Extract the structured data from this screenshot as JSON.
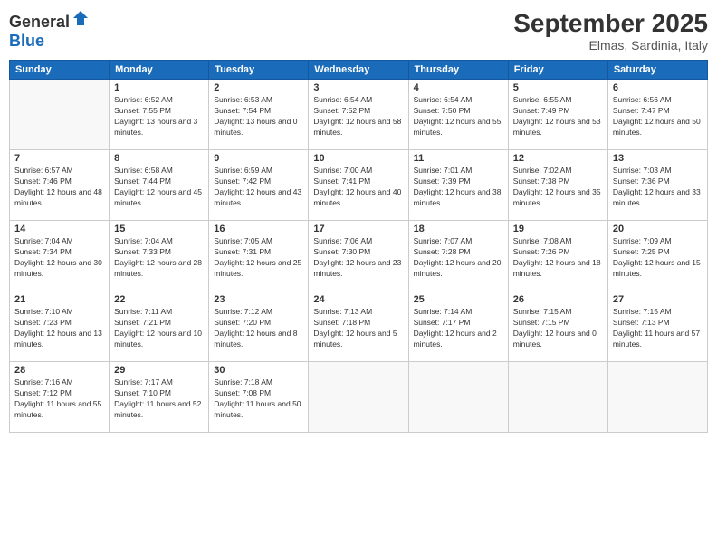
{
  "logo": {
    "general": "General",
    "blue": "Blue"
  },
  "header": {
    "month": "September 2025",
    "location": "Elmas, Sardinia, Italy"
  },
  "weekdays": [
    "Sunday",
    "Monday",
    "Tuesday",
    "Wednesday",
    "Thursday",
    "Friday",
    "Saturday"
  ],
  "weeks": [
    [
      {
        "day": "",
        "sunrise": "",
        "sunset": "",
        "daylight": ""
      },
      {
        "day": "1",
        "sunrise": "Sunrise: 6:52 AM",
        "sunset": "Sunset: 7:55 PM",
        "daylight": "Daylight: 13 hours and 3 minutes."
      },
      {
        "day": "2",
        "sunrise": "Sunrise: 6:53 AM",
        "sunset": "Sunset: 7:54 PM",
        "daylight": "Daylight: 13 hours and 0 minutes."
      },
      {
        "day": "3",
        "sunrise": "Sunrise: 6:54 AM",
        "sunset": "Sunset: 7:52 PM",
        "daylight": "Daylight: 12 hours and 58 minutes."
      },
      {
        "day": "4",
        "sunrise": "Sunrise: 6:54 AM",
        "sunset": "Sunset: 7:50 PM",
        "daylight": "Daylight: 12 hours and 55 minutes."
      },
      {
        "day": "5",
        "sunrise": "Sunrise: 6:55 AM",
        "sunset": "Sunset: 7:49 PM",
        "daylight": "Daylight: 12 hours and 53 minutes."
      },
      {
        "day": "6",
        "sunrise": "Sunrise: 6:56 AM",
        "sunset": "Sunset: 7:47 PM",
        "daylight": "Daylight: 12 hours and 50 minutes."
      }
    ],
    [
      {
        "day": "7",
        "sunrise": "Sunrise: 6:57 AM",
        "sunset": "Sunset: 7:46 PM",
        "daylight": "Daylight: 12 hours and 48 minutes."
      },
      {
        "day": "8",
        "sunrise": "Sunrise: 6:58 AM",
        "sunset": "Sunset: 7:44 PM",
        "daylight": "Daylight: 12 hours and 45 minutes."
      },
      {
        "day": "9",
        "sunrise": "Sunrise: 6:59 AM",
        "sunset": "Sunset: 7:42 PM",
        "daylight": "Daylight: 12 hours and 43 minutes."
      },
      {
        "day": "10",
        "sunrise": "Sunrise: 7:00 AM",
        "sunset": "Sunset: 7:41 PM",
        "daylight": "Daylight: 12 hours and 40 minutes."
      },
      {
        "day": "11",
        "sunrise": "Sunrise: 7:01 AM",
        "sunset": "Sunset: 7:39 PM",
        "daylight": "Daylight: 12 hours and 38 minutes."
      },
      {
        "day": "12",
        "sunrise": "Sunrise: 7:02 AM",
        "sunset": "Sunset: 7:38 PM",
        "daylight": "Daylight: 12 hours and 35 minutes."
      },
      {
        "day": "13",
        "sunrise": "Sunrise: 7:03 AM",
        "sunset": "Sunset: 7:36 PM",
        "daylight": "Daylight: 12 hours and 33 minutes."
      }
    ],
    [
      {
        "day": "14",
        "sunrise": "Sunrise: 7:04 AM",
        "sunset": "Sunset: 7:34 PM",
        "daylight": "Daylight: 12 hours and 30 minutes."
      },
      {
        "day": "15",
        "sunrise": "Sunrise: 7:04 AM",
        "sunset": "Sunset: 7:33 PM",
        "daylight": "Daylight: 12 hours and 28 minutes."
      },
      {
        "day": "16",
        "sunrise": "Sunrise: 7:05 AM",
        "sunset": "Sunset: 7:31 PM",
        "daylight": "Daylight: 12 hours and 25 minutes."
      },
      {
        "day": "17",
        "sunrise": "Sunrise: 7:06 AM",
        "sunset": "Sunset: 7:30 PM",
        "daylight": "Daylight: 12 hours and 23 minutes."
      },
      {
        "day": "18",
        "sunrise": "Sunrise: 7:07 AM",
        "sunset": "Sunset: 7:28 PM",
        "daylight": "Daylight: 12 hours and 20 minutes."
      },
      {
        "day": "19",
        "sunrise": "Sunrise: 7:08 AM",
        "sunset": "Sunset: 7:26 PM",
        "daylight": "Daylight: 12 hours and 18 minutes."
      },
      {
        "day": "20",
        "sunrise": "Sunrise: 7:09 AM",
        "sunset": "Sunset: 7:25 PM",
        "daylight": "Daylight: 12 hours and 15 minutes."
      }
    ],
    [
      {
        "day": "21",
        "sunrise": "Sunrise: 7:10 AM",
        "sunset": "Sunset: 7:23 PM",
        "daylight": "Daylight: 12 hours and 13 minutes."
      },
      {
        "day": "22",
        "sunrise": "Sunrise: 7:11 AM",
        "sunset": "Sunset: 7:21 PM",
        "daylight": "Daylight: 12 hours and 10 minutes."
      },
      {
        "day": "23",
        "sunrise": "Sunrise: 7:12 AM",
        "sunset": "Sunset: 7:20 PM",
        "daylight": "Daylight: 12 hours and 8 minutes."
      },
      {
        "day": "24",
        "sunrise": "Sunrise: 7:13 AM",
        "sunset": "Sunset: 7:18 PM",
        "daylight": "Daylight: 12 hours and 5 minutes."
      },
      {
        "day": "25",
        "sunrise": "Sunrise: 7:14 AM",
        "sunset": "Sunset: 7:17 PM",
        "daylight": "Daylight: 12 hours and 2 minutes."
      },
      {
        "day": "26",
        "sunrise": "Sunrise: 7:15 AM",
        "sunset": "Sunset: 7:15 PM",
        "daylight": "Daylight: 12 hours and 0 minutes."
      },
      {
        "day": "27",
        "sunrise": "Sunrise: 7:15 AM",
        "sunset": "Sunset: 7:13 PM",
        "daylight": "Daylight: 11 hours and 57 minutes."
      }
    ],
    [
      {
        "day": "28",
        "sunrise": "Sunrise: 7:16 AM",
        "sunset": "Sunset: 7:12 PM",
        "daylight": "Daylight: 11 hours and 55 minutes."
      },
      {
        "day": "29",
        "sunrise": "Sunrise: 7:17 AM",
        "sunset": "Sunset: 7:10 PM",
        "daylight": "Daylight: 11 hours and 52 minutes."
      },
      {
        "day": "30",
        "sunrise": "Sunrise: 7:18 AM",
        "sunset": "Sunset: 7:08 PM",
        "daylight": "Daylight: 11 hours and 50 minutes."
      },
      {
        "day": "",
        "sunrise": "",
        "sunset": "",
        "daylight": ""
      },
      {
        "day": "",
        "sunrise": "",
        "sunset": "",
        "daylight": ""
      },
      {
        "day": "",
        "sunrise": "",
        "sunset": "",
        "daylight": ""
      },
      {
        "day": "",
        "sunrise": "",
        "sunset": "",
        "daylight": ""
      }
    ]
  ]
}
